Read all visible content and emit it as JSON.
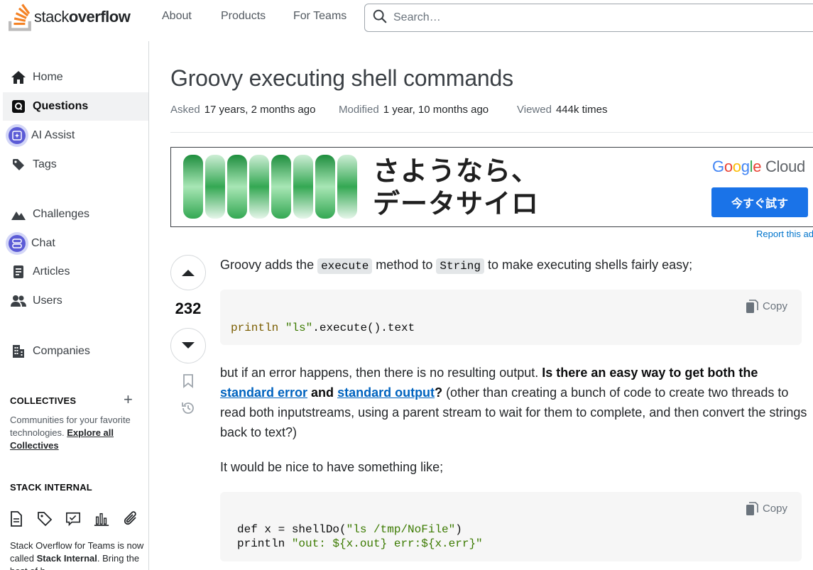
{
  "header": {
    "logo_text_light": "stack",
    "logo_text_bold": "overflow",
    "nav": [
      "About",
      "Products",
      "For Teams"
    ],
    "search_placeholder": "Search…"
  },
  "sidebar": {
    "items": [
      {
        "label": "Home",
        "icon": "home-icon"
      },
      {
        "label": "Questions",
        "icon": "questions-icon",
        "active": true
      },
      {
        "label": "AI Assist",
        "icon": "ai-assist-icon"
      },
      {
        "label": "Tags",
        "icon": "tag-icon"
      },
      {
        "label": "Challenges",
        "icon": "challenges-icon"
      },
      {
        "label": "Chat",
        "icon": "chat-icon"
      },
      {
        "label": "Articles",
        "icon": "articles-icon"
      },
      {
        "label": "Users",
        "icon": "users-icon"
      },
      {
        "label": "Companies",
        "icon": "companies-icon"
      }
    ],
    "collectives_heading": "COLLECTIVES",
    "collectives_desc": "Communities for your favorite technologies.",
    "collectives_link": "Explore all Collectives",
    "stack_internal_heading": "STACK INTERNAL",
    "stack_internal_text_1": "Stack Overflow for Teams is now called",
    "stack_internal_bold": "Stack Internal",
    "stack_internal_text_2": ". Bring the best of h"
  },
  "question": {
    "title": "Groovy executing shell commands",
    "asked_label": "Asked",
    "asked_value": "17 years, 2 months ago",
    "modified_label": "Modified",
    "modified_value": "1 year, 10 months ago",
    "viewed_label": "Viewed",
    "viewed_value": "444k times",
    "score": "232"
  },
  "ad": {
    "line1": "さようなら、",
    "line2": "データサイロ",
    "brand_google": "Google",
    "brand_cloud": " Cloud",
    "button": "今すぐ試す",
    "report": "Report this ad"
  },
  "body": {
    "p1_a": "Groovy adds the ",
    "p1_code1": "execute",
    "p1_b": " method to ",
    "p1_code2": "String",
    "p1_c": " to make executing shells fairly easy;",
    "code1_fn": "println",
    "code1_str": "\"ls\"",
    "code1_rest": ".execute().text",
    "copy_label": "Copy",
    "p2_a": "but if an error happens, then there is no resulting output. ",
    "p2_bold1": "Is there an easy way to get both the ",
    "p2_link1": "standard error",
    "p2_bold2": " and ",
    "p2_link2": "standard output",
    "p2_bold3": "?",
    "p2_b": " (other than creating a bunch of code to create two threads to read both inputstreams, using a parent stream to wait for them to complete, and then convert the strings back to text?)",
    "p3": "It would be nice to have something like;",
    "code2_l1_a": "def x = shellDo(",
    "code2_l1_str": "\"ls /tmp/NoFile\"",
    "code2_l1_b": ")",
    "code2_l2_a": "println ",
    "code2_l2_str": "\"out: ${x.out} err:${x.err}\""
  },
  "colors": {
    "accent_orange": "#f48225",
    "link_blue": "#0063bf",
    "ad_button_blue": "#1a73e8",
    "ai_purple": "#5b5bd6"
  }
}
